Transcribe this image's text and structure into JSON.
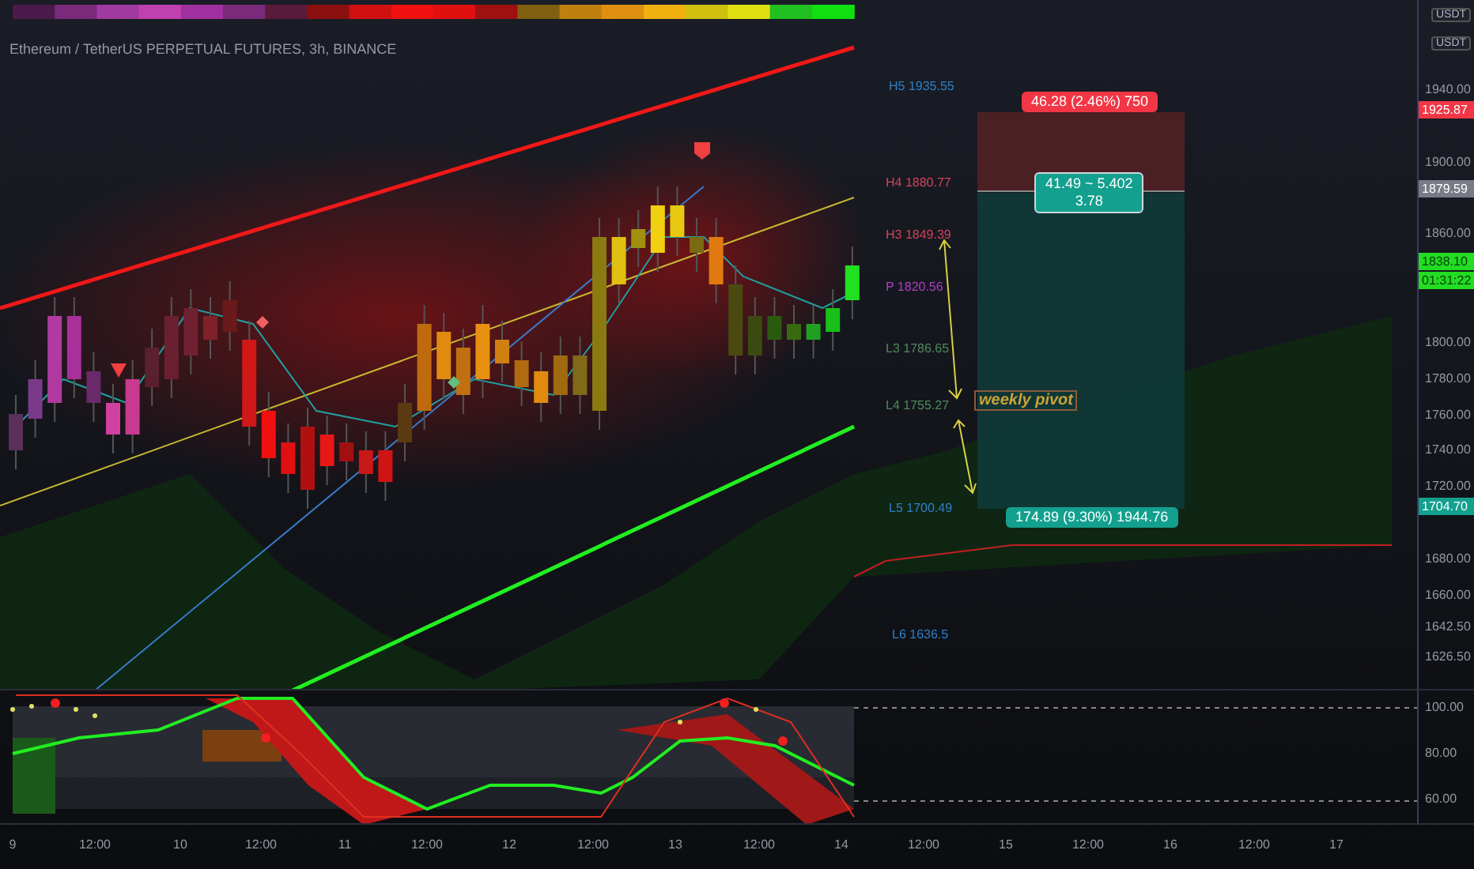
{
  "header": {
    "title": "Ethereum / TetherUS PERPETUAL FUTURES, 3h, BINANCE"
  },
  "currency_tags": [
    "USDT",
    "USDT"
  ],
  "pivots": [
    {
      "label": "H5 1935.55",
      "color": "#2f7fc8"
    },
    {
      "label": "H4 1880.77",
      "color": "#d0455a"
    },
    {
      "label": "H3 1849.39",
      "color": "#d0455a"
    },
    {
      "label": "P 1820.56",
      "color": "#b03cc8"
    },
    {
      "label": "L3 1786.65",
      "color": "#4f8a5a"
    },
    {
      "label": "L4 1755.27",
      "color": "#4f8a5a"
    },
    {
      "label": "L5 1700.49",
      "color": "#2f7fc8"
    },
    {
      "label": "L6 1636.5",
      "color": "#2f7fc8"
    }
  ],
  "position": {
    "target_label": "46.28 (2.46%) 750",
    "ratio_lines": [
      "41.49 ~ 5.402",
      "3.78"
    ],
    "stop_label": "174.89 (9.30%) 1944.76"
  },
  "annotation": {
    "text": "weekly pivot"
  },
  "price_axis": {
    "ticks": [
      "1940.00",
      "1900.00",
      "1860.00",
      "1800.00",
      "1780.00",
      "1760.00",
      "1740.00",
      "1720.00",
      "1680.00",
      "1660.00",
      "1642.50",
      "1626.50"
    ],
    "badges": [
      {
        "text": "1925.87",
        "color": "#f23645"
      },
      {
        "text": "1879.59",
        "color": "#787b86"
      },
      {
        "text": "1838.10",
        "color": "#22dd22"
      },
      {
        "text": "01:31:22",
        "color": "#22dd22"
      },
      {
        "text": "1704.70",
        "color": "#13a08e"
      }
    ]
  },
  "oscillator_axis": {
    "ticks": [
      "100.00",
      "80.00",
      "60.00"
    ]
  },
  "time_axis": {
    "labels": [
      "9",
      "12:00",
      "10",
      "12:00",
      "11",
      "12:00",
      "12",
      "12:00",
      "13",
      "12:00",
      "14",
      "12:00",
      "15",
      "12:00",
      "16",
      "12:00",
      "17"
    ]
  }
}
